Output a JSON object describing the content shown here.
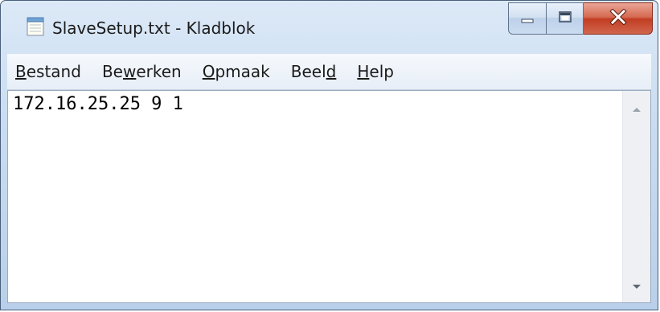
{
  "window": {
    "title": "SlaveSetup.txt - Kladblok"
  },
  "menu": {
    "items": [
      {
        "pre": "",
        "accel": "B",
        "post": "estand"
      },
      {
        "pre": "Be",
        "accel": "w",
        "post": "erken"
      },
      {
        "pre": "",
        "accel": "O",
        "post": "pmaak"
      },
      {
        "pre": "Beel",
        "accel": "d",
        "post": ""
      },
      {
        "pre": "",
        "accel": "H",
        "post": "elp"
      }
    ]
  },
  "editor": {
    "content": "172.16.25.25 9 1"
  },
  "icons": {
    "app": "notepad-icon",
    "minimize": "minimize-icon",
    "maximize": "maximize-icon",
    "close": "close-icon",
    "scroll_up": "scroll-up-arrow-icon",
    "scroll_down": "scroll-down-arrow-icon"
  },
  "colors": {
    "close_button": "#c23d22",
    "title_gradient_top": "#dce9f7",
    "title_gradient_bottom": "#b9d0ea"
  }
}
